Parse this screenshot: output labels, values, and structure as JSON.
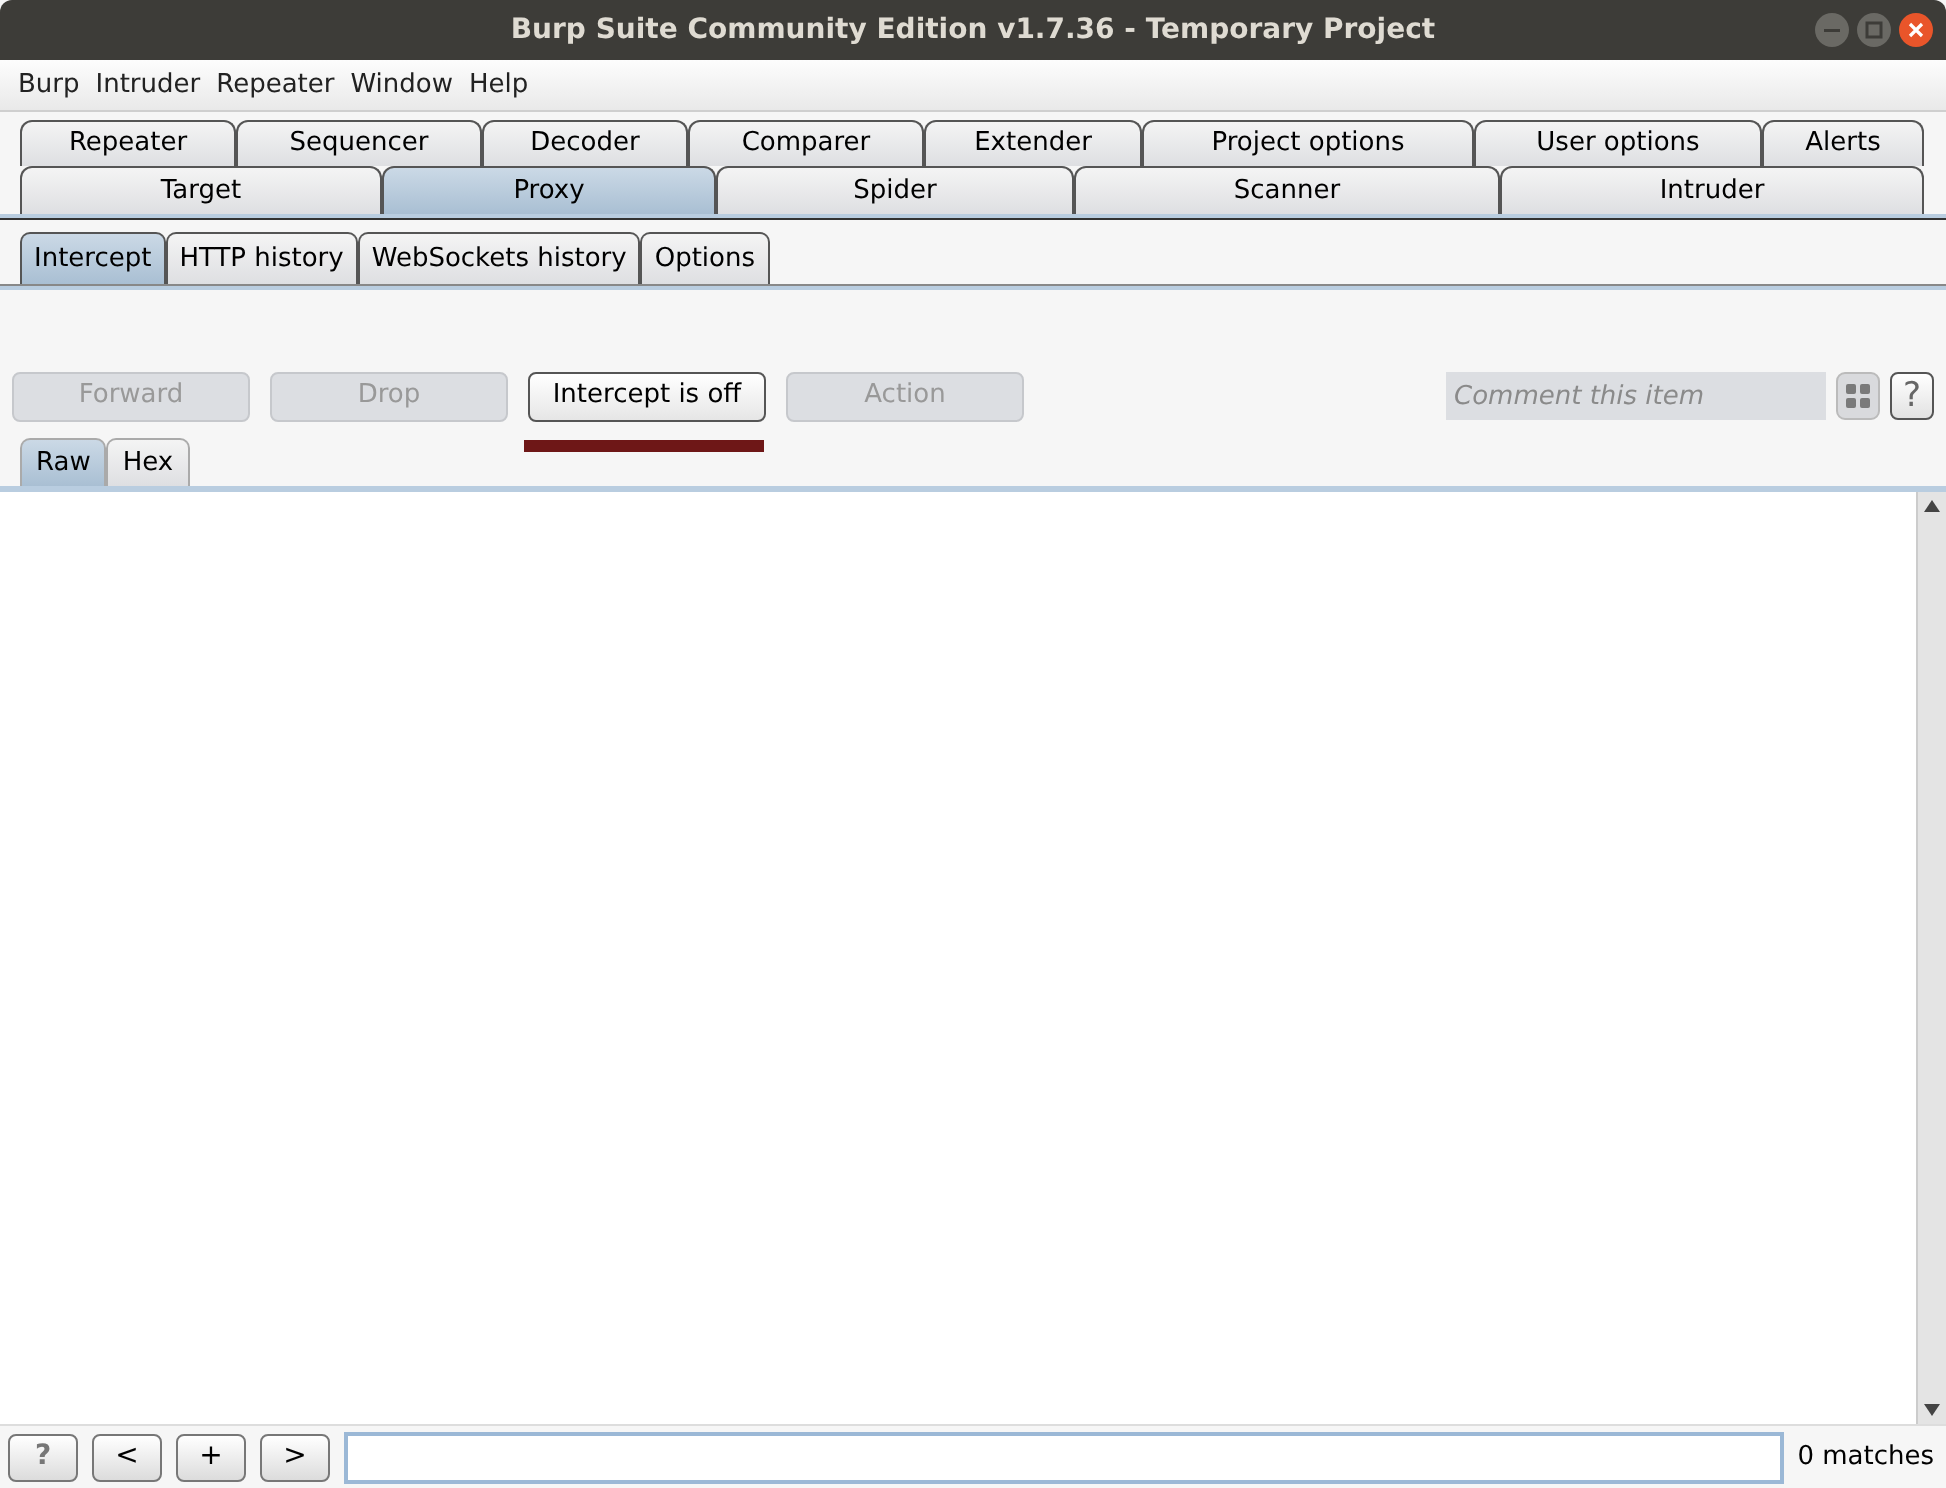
{
  "window": {
    "title": "Burp Suite Community Edition v1.7.36 - Temporary Project"
  },
  "menu": [
    "Burp",
    "Intruder",
    "Repeater",
    "Window",
    "Help"
  ],
  "tabs_row_1": [
    {
      "label": "Repeater",
      "selected": false
    },
    {
      "label": "Sequencer",
      "selected": false
    },
    {
      "label": "Decoder",
      "selected": false
    },
    {
      "label": "Comparer",
      "selected": false
    },
    {
      "label": "Extender",
      "selected": false
    },
    {
      "label": "Project options",
      "selected": false
    },
    {
      "label": "User options",
      "selected": false
    },
    {
      "label": "Alerts",
      "selected": false
    }
  ],
  "tabs_row_2": [
    {
      "label": "Target",
      "selected": false
    },
    {
      "label": "Proxy",
      "selected": true
    },
    {
      "label": "Spider",
      "selected": false
    },
    {
      "label": "Scanner",
      "selected": false
    },
    {
      "label": "Intruder",
      "selected": false
    }
  ],
  "sub_tabs": [
    {
      "label": "Intercept",
      "selected": true
    },
    {
      "label": "HTTP history",
      "selected": false
    },
    {
      "label": "WebSockets history",
      "selected": false
    },
    {
      "label": "Options",
      "selected": false
    }
  ],
  "actions": [
    {
      "label": "Forward",
      "disabled": true
    },
    {
      "label": "Drop",
      "disabled": true
    },
    {
      "label": "Intercept is off",
      "disabled": false
    },
    {
      "label": "Action",
      "disabled": true
    }
  ],
  "comment": {
    "placeholder": "Comment this item"
  },
  "help_button": "?",
  "view_tabs": [
    {
      "label": "Raw",
      "selected": true
    },
    {
      "label": "Hex",
      "selected": false
    }
  ],
  "search_bar": {
    "buttons": [
      "?",
      "<",
      "+",
      ">"
    ],
    "matches": "0 matches"
  }
}
